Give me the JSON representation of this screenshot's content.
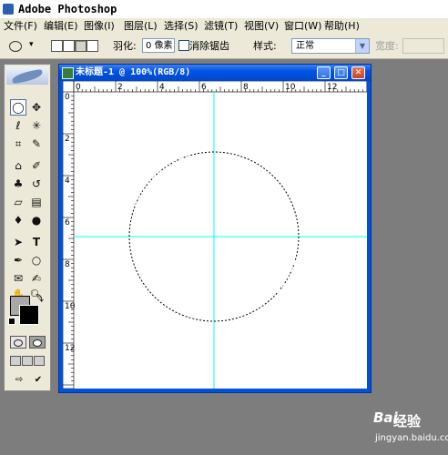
{
  "app": {
    "title": "Adobe Photoshop"
  },
  "menu": [
    "文件(F)",
    "编辑(E)",
    "图像(I)",
    "图层(L)",
    "选择(S)",
    "滤镜(T)",
    "视图(V)",
    "窗口(W)",
    "帮助(H)"
  ],
  "options": {
    "feather_label": "羽化:",
    "feather_value": "0 像素",
    "antialias_label": "消除锯齿",
    "style_label": "样式:",
    "style_value": "正常",
    "width_label": "宽度:"
  },
  "document": {
    "title": "未标题-1 @ 100%(RGB/8)",
    "ruler_top": [
      "0",
      "2",
      "4",
      "6",
      "8",
      "10",
      "12"
    ],
    "ruler_left": [
      "0",
      "2",
      "4",
      "6",
      "8",
      "10",
      "12"
    ]
  },
  "toolbox": {
    "tools": [
      "marquee-tool",
      "move-tool",
      "lasso-tool",
      "magic-wand-tool",
      "crop-tool",
      "slice-tool",
      "healing-brush-tool",
      "brush-tool",
      "clone-stamp-tool",
      "history-brush-tool",
      "eraser-tool",
      "gradient-tool",
      "blur-tool",
      "dodge-tool",
      "path-selection-tool",
      "type-tool",
      "pen-tool",
      "shape-tool",
      "notes-tool",
      "eyedropper-tool",
      "hand-tool",
      "zoom-tool"
    ],
    "foreground_color": "#a8a8a8",
    "background_color": "#000000"
  },
  "colors": {
    "guide": "#00ffff",
    "window_title": "#0054e3",
    "workspace": "#7d7d7d"
  },
  "watermark": {
    "brand": "Bai",
    "label": "经验",
    "url": "jingyan.baidu.com"
  }
}
